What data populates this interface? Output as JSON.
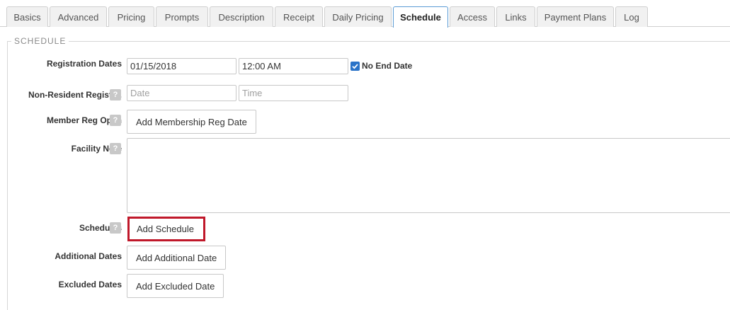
{
  "tabs": [
    {
      "label": "Basics"
    },
    {
      "label": "Advanced"
    },
    {
      "label": "Pricing"
    },
    {
      "label": "Prompts"
    },
    {
      "label": "Description"
    },
    {
      "label": "Receipt"
    },
    {
      "label": "Daily Pricing"
    },
    {
      "label": "Schedule",
      "active": true
    },
    {
      "label": "Access"
    },
    {
      "label": "Links"
    },
    {
      "label": "Payment Plans"
    },
    {
      "label": "Log"
    }
  ],
  "section": {
    "legend": "SCHEDULE"
  },
  "help_glyph": "?",
  "registration_dates": {
    "label": "Registration Dates",
    "date_value": "01/15/2018",
    "time_value": "12:00 AM",
    "no_end_date_label": "No End Date",
    "no_end_date_checked": true
  },
  "non_resident": {
    "label": "Non-Resident Registr...",
    "date_placeholder": "Date",
    "time_placeholder": "Time"
  },
  "member_reg_open": {
    "label": "Member Reg Open",
    "button_label": "Add Membership Reg Date"
  },
  "facility_note": {
    "label": "Facility Note",
    "value": ""
  },
  "schedules": {
    "label": "Schedules",
    "button_label": "Add Schedule"
  },
  "additional_dates": {
    "label": "Additional Dates",
    "button_label": "Add Additional Date"
  },
  "excluded_dates": {
    "label": "Excluded Dates",
    "button_label": "Add Excluded Date"
  },
  "colors": {
    "active_tab_border": "#5b9bd5",
    "highlight": "#c0182a",
    "checkbox": "#2a73c8"
  }
}
